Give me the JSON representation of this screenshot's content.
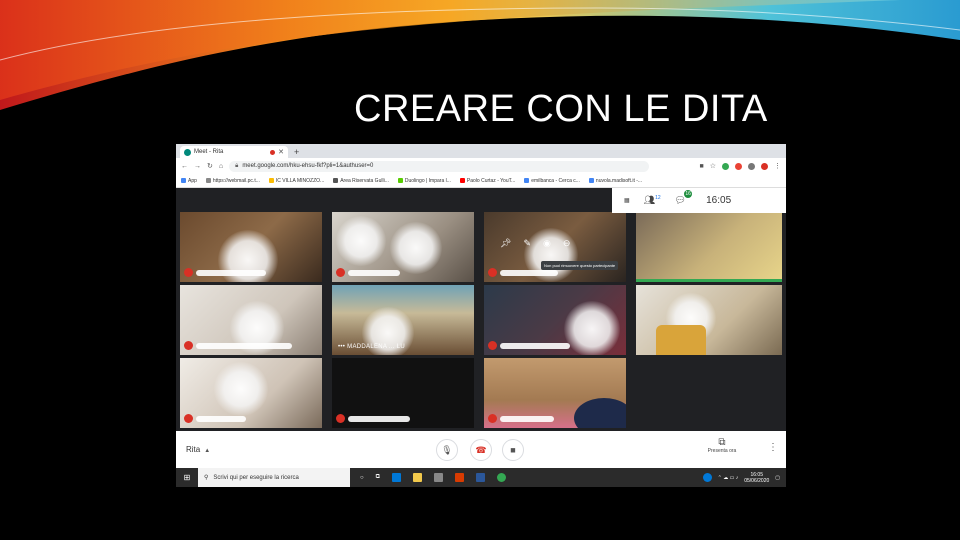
{
  "slide": {
    "title": "CREARE CON LE DITA"
  },
  "browser": {
    "tab_title": "Meet - Rita",
    "new_tab": "+",
    "url": "meet.google.com/hku-ehsu-fkf?pli=1&authuser=0",
    "bookmarks": [
      {
        "label": "App",
        "color": "#4285f4"
      },
      {
        "label": "https://webmail.pc.t...",
        "color": "#888888"
      },
      {
        "label": "IC VILLA MINOZZO...",
        "color": "#fbbc04"
      },
      {
        "label": "Area Riservata Gulli...",
        "color": "#555555"
      },
      {
        "label": "Duolingo | Impara l...",
        "color": "#58cc02"
      },
      {
        "label": "Paolo Curtaz - YouT...",
        "color": "#ff0000"
      },
      {
        "label": "emilbanca - Cerca c...",
        "color": "#4285f4"
      },
      {
        "label": "nuvola.madisoft.it -...",
        "color": "#4285f4"
      }
    ]
  },
  "meet": {
    "clock": "16:05",
    "participants_count": "12",
    "chat_count": "16",
    "tooltip": "Non puoi rimuovere questo partecipante",
    "tile_name": "MADDALENA ... LU",
    "user_name": "Rita",
    "present_label": "Presenta ora"
  },
  "taskbar": {
    "search_placeholder": "Scrivi qui per eseguire la ricerca",
    "time": "16:05",
    "date": "05/06/2020"
  }
}
